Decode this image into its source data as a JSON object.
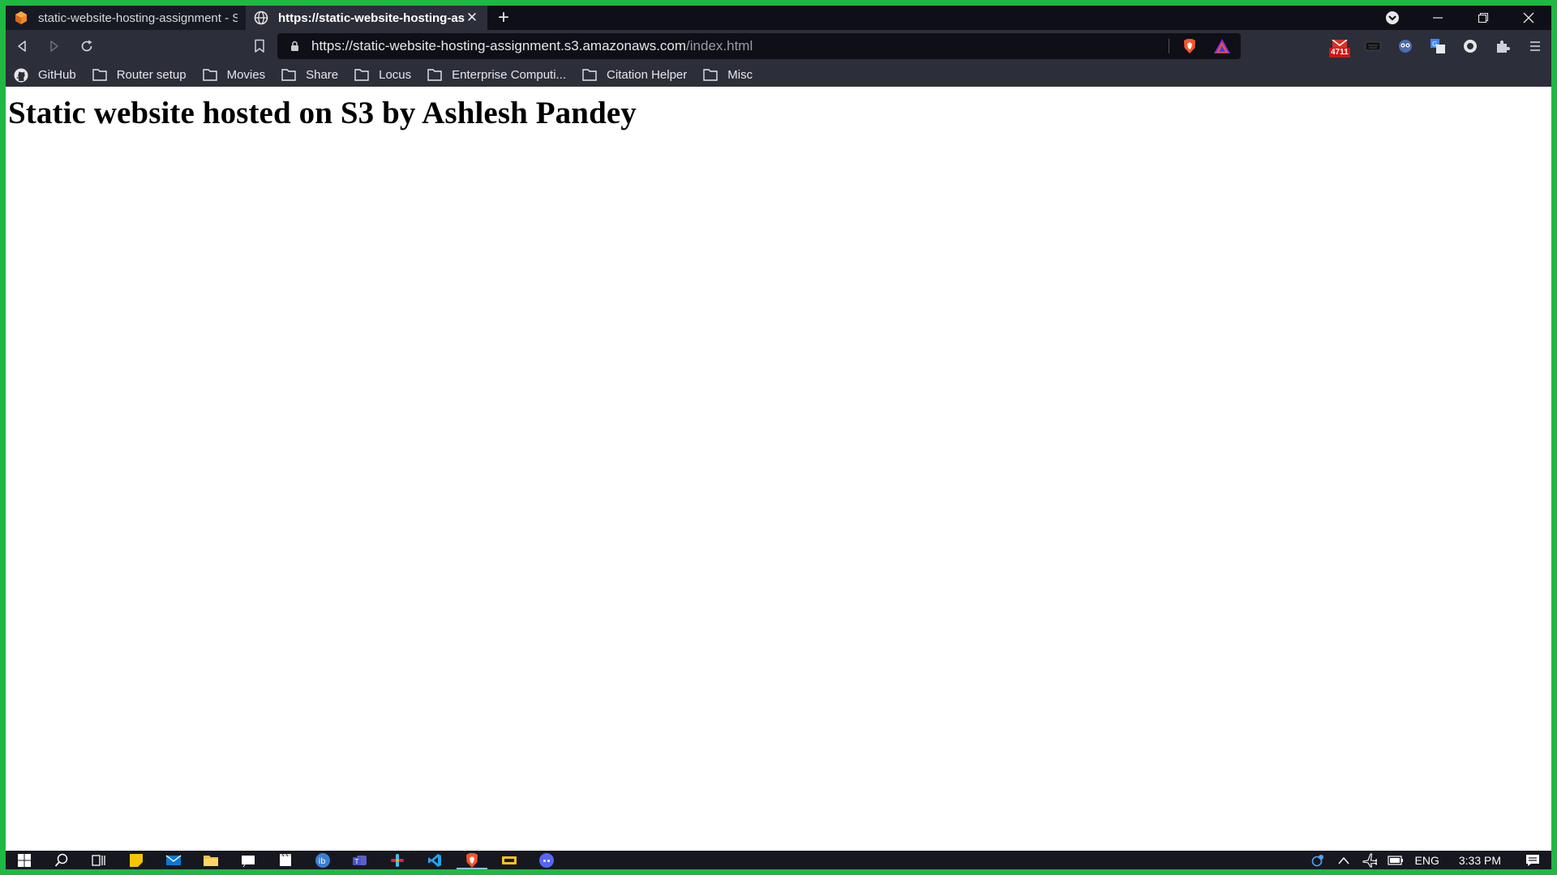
{
  "tabs": [
    {
      "title": "static-website-hosting-assignment - S",
      "active": false,
      "favicon": "aws-cube-icon"
    },
    {
      "title": "https://static-website-hosting-ass",
      "active": true,
      "favicon": "globe-icon",
      "close": "✕"
    }
  ],
  "new_tab_label": "+",
  "address": {
    "host": "https://static-website-hosting-assignment.s3.amazonaws.com",
    "path": "/index.html"
  },
  "extensions": {
    "gmail_badge": "4711"
  },
  "bookmarks": [
    {
      "label": "GitHub",
      "icon": "github-icon"
    },
    {
      "label": "Router setup",
      "icon": "folder-icon"
    },
    {
      "label": "Movies",
      "icon": "folder-icon"
    },
    {
      "label": "Share",
      "icon": "folder-icon"
    },
    {
      "label": "Locus",
      "icon": "folder-icon"
    },
    {
      "label": "Enterprise Computi...",
      "icon": "folder-icon"
    },
    {
      "label": "Citation Helper",
      "icon": "folder-icon"
    },
    {
      "label": "Misc",
      "icon": "folder-icon"
    }
  ],
  "page": {
    "heading": "Static website hosted on S3 by Ashlesh Pandey"
  },
  "taskbar": {
    "language": "ENG",
    "time": "3:33 PM"
  },
  "colors": {
    "border_green": "#1fb842",
    "tab_strip": "#0e0f17",
    "toolbar": "#2c2e39"
  }
}
